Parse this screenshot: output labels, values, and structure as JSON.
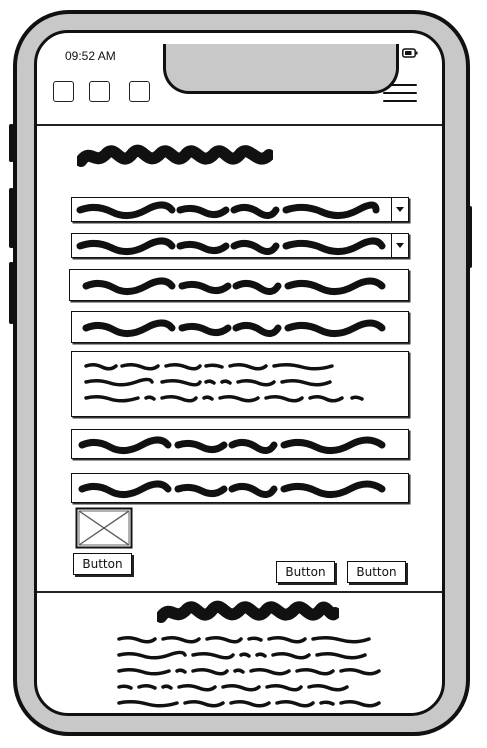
{
  "status_bar": {
    "time": "09:52 AM",
    "icons": [
      "signal-icon",
      "wifi-icon",
      "battery-icon"
    ]
  },
  "top_bar": {
    "left_icons": [
      "square-icon",
      "square-icon",
      "square-icon"
    ],
    "menu_icon": "hamburger-icon"
  },
  "form": {
    "fields": [
      {
        "kind": "dropdown"
      },
      {
        "kind": "dropdown"
      },
      {
        "kind": "text-input"
      },
      {
        "kind": "text-input"
      },
      {
        "kind": "textarea"
      },
      {
        "kind": "text-input"
      },
      {
        "kind": "text-input"
      }
    ],
    "image_placeholder": "image-placeholder-icon",
    "buttons": {
      "left": "Button",
      "right_1": "Button",
      "right_2": "Button"
    }
  },
  "colors": {
    "frame": "#c8c8c8",
    "ink": "#111111",
    "screen": "#ffffff"
  }
}
